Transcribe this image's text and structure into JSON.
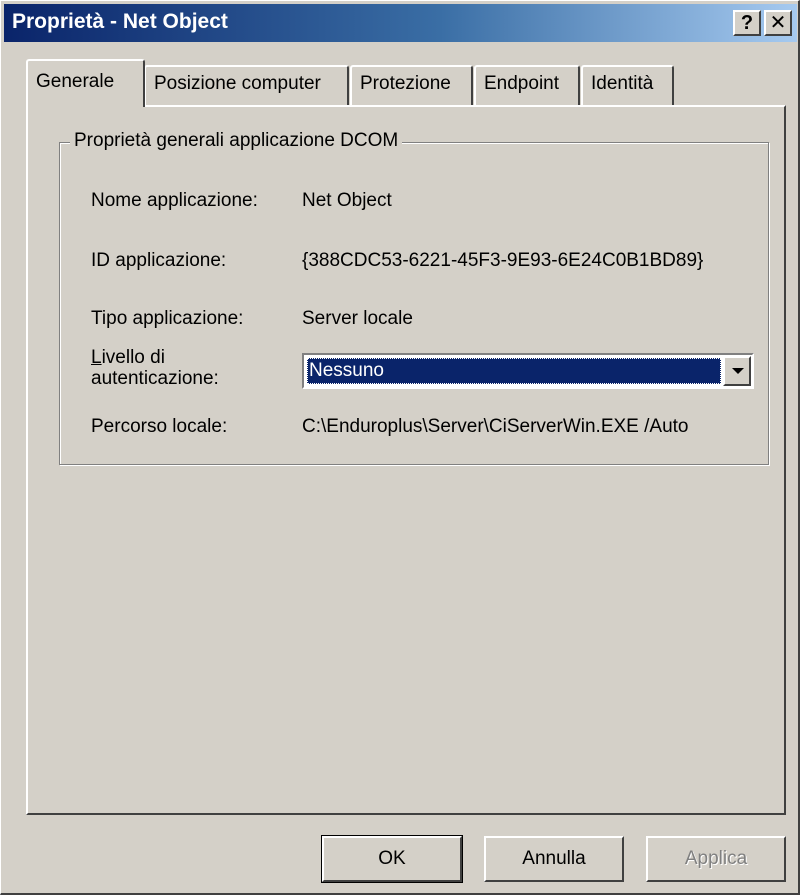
{
  "window": {
    "title": "Proprietà - Net Object",
    "help_label": "?",
    "close_label": "✕"
  },
  "tabs": [
    {
      "label": "Generale",
      "active": true
    },
    {
      "label": "Posizione computer",
      "active": false
    },
    {
      "label": "Protezione",
      "active": false
    },
    {
      "label": "Endpoint",
      "active": false
    },
    {
      "label": "Identità",
      "active": false
    }
  ],
  "group": {
    "legend": "Proprietà generali applicazione DCOM",
    "rows": [
      {
        "label": "Nome applicazione:",
        "value": "Net Object"
      },
      {
        "label": "ID applicazione:",
        "value": "{388CDC53-6221-45F3-9E93-6E24C0B1BD89}"
      },
      {
        "label": "Tipo applicazione:",
        "value": "Server locale"
      },
      {
        "label_accel": "L",
        "label_rest_line1": "ivello di",
        "label_line2": "autenticazione:",
        "value": "Nessuno"
      },
      {
        "label": "Percorso locale:",
        "value": "C:\\Enduroplus\\Server\\CiServerWin.EXE /Auto"
      }
    ]
  },
  "buttons": {
    "ok": "OK",
    "cancel": "Annulla",
    "apply": "Applica"
  },
  "colors": {
    "face": "#d4d0c8",
    "title_start": "#0a246a",
    "title_end": "#a6caf0",
    "selection": "#0a246a"
  }
}
